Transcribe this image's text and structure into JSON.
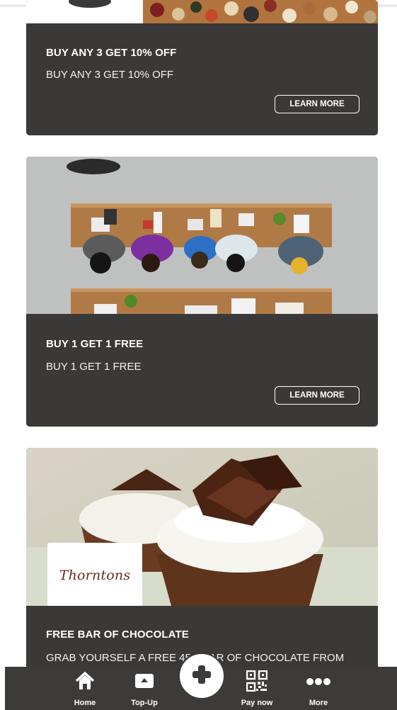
{
  "colors": {
    "card_background": "#3a3938",
    "nav_background": "#3c3b3a",
    "text": "#ffffff",
    "page_background": "#ffffff"
  },
  "offers": [
    {
      "title": "BUY ANY 3 GET 10% OFF",
      "description": "BUY ANY 3 GET 10% OFF",
      "button_label": "LEARN MORE",
      "image": "food-platter-photo"
    },
    {
      "title": "BUY 1 GET 1 FREE",
      "description": "BUY 1 GET 1 FREE",
      "button_label": "LEARN MORE",
      "image": "office-desk-people-photo"
    },
    {
      "title": "FREE BAR OF CHOCOLATE",
      "description": "GRAB YOURSELF A FREE 45G BAR OF CHOCOLATE FROM",
      "brand_logo_text": "Thorntons",
      "image": "chocolate-cupcake-photo"
    }
  ],
  "bottom_nav": {
    "items": [
      {
        "label": "Home",
        "icon": "home-icon"
      },
      {
        "label": "Top-Up",
        "icon": "top-up-icon"
      },
      {
        "label": "Pay now",
        "icon": "qr-code-icon"
      },
      {
        "label": "More",
        "icon": "more-dots-icon"
      }
    ],
    "center_action_icon": "plus-icon"
  }
}
